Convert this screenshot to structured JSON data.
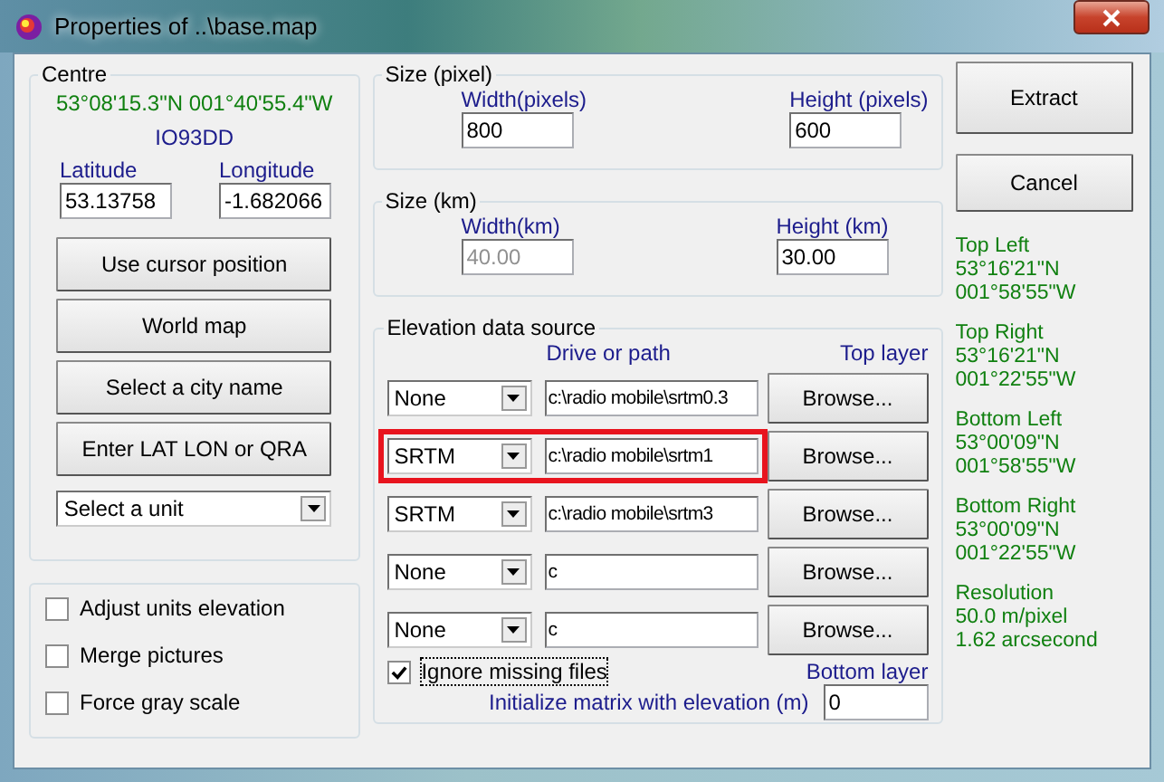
{
  "window": {
    "title": "Properties of ..\\base.map"
  },
  "centre": {
    "legend": "Centre",
    "coordinates": "53°08'15.3\"N 001°40'55.4\"W",
    "locator": "IO93DD",
    "latitude": {
      "label": "Latitude",
      "value": "53.13758"
    },
    "longitude": {
      "label": "Longitude",
      "value": "-1.682066"
    },
    "buttons": [
      "Use cursor position",
      "World map",
      "Select a city name",
      "Enter LAT LON or QRA"
    ],
    "unit_select": {
      "value": "Select a unit"
    }
  },
  "options": [
    {
      "label": "Adjust units elevation",
      "checked": false
    },
    {
      "label": "Merge pictures",
      "checked": false
    },
    {
      "label": "Force gray scale",
      "checked": false
    }
  ],
  "size_pixel": {
    "legend": "Size (pixel)",
    "fields": [
      {
        "label": "Width(pixels)",
        "value": "800",
        "disabled": false
      },
      {
        "label": "Height (pixels)",
        "value": "600",
        "disabled": false
      }
    ]
  },
  "size_km": {
    "legend": "Size (km)",
    "fields": [
      {
        "label": "Width(km)",
        "value": "40.00",
        "disabled": true
      },
      {
        "label": "Height (km)",
        "value": "30.00",
        "disabled": false
      }
    ]
  },
  "elevation": {
    "legend": "Elevation data source",
    "path_header": "Drive or path",
    "top_label": "Top layer",
    "bottom_label": "Bottom layer",
    "rows": [
      {
        "source": "None",
        "path": "c:\\radio mobile\\srtm0.3",
        "button": "Browse...",
        "highlighted": false
      },
      {
        "source": "SRTM",
        "path": "c:\\radio mobile\\srtm1",
        "button": "Browse...",
        "highlighted": true
      },
      {
        "source": "SRTM",
        "path": "c:\\radio mobile\\srtm3",
        "button": "Browse...",
        "highlighted": false
      },
      {
        "source": "None",
        "path": "c",
        "button": "Browse...",
        "highlighted": false
      },
      {
        "source": "None",
        "path": "c",
        "button": "Browse...",
        "highlighted": false
      }
    ],
    "ignore_missing": {
      "label": "Ignore missing files",
      "checked": true
    },
    "init_label": "Initialize matrix with elevation (m)",
    "init_value": "0"
  },
  "actions": [
    "Extract",
    "Cancel"
  ],
  "info": [
    {
      "title": "Top Left",
      "lines": [
        "53°16'21\"N",
        "001°58'55\"W"
      ]
    },
    {
      "title": "Top Right",
      "lines": [
        "53°16'21\"N",
        "001°22'55\"W"
      ]
    },
    {
      "title": "Bottom Left",
      "lines": [
        "53°00'09\"N",
        "001°58'55\"W"
      ]
    },
    {
      "title": "Bottom Right",
      "lines": [
        "53°00'09\"N",
        "001°22'55\"W"
      ]
    },
    {
      "title": "Resolution",
      "lines": [
        "50.0 m/pixel",
        "1.62 arcsecond"
      ]
    }
  ]
}
